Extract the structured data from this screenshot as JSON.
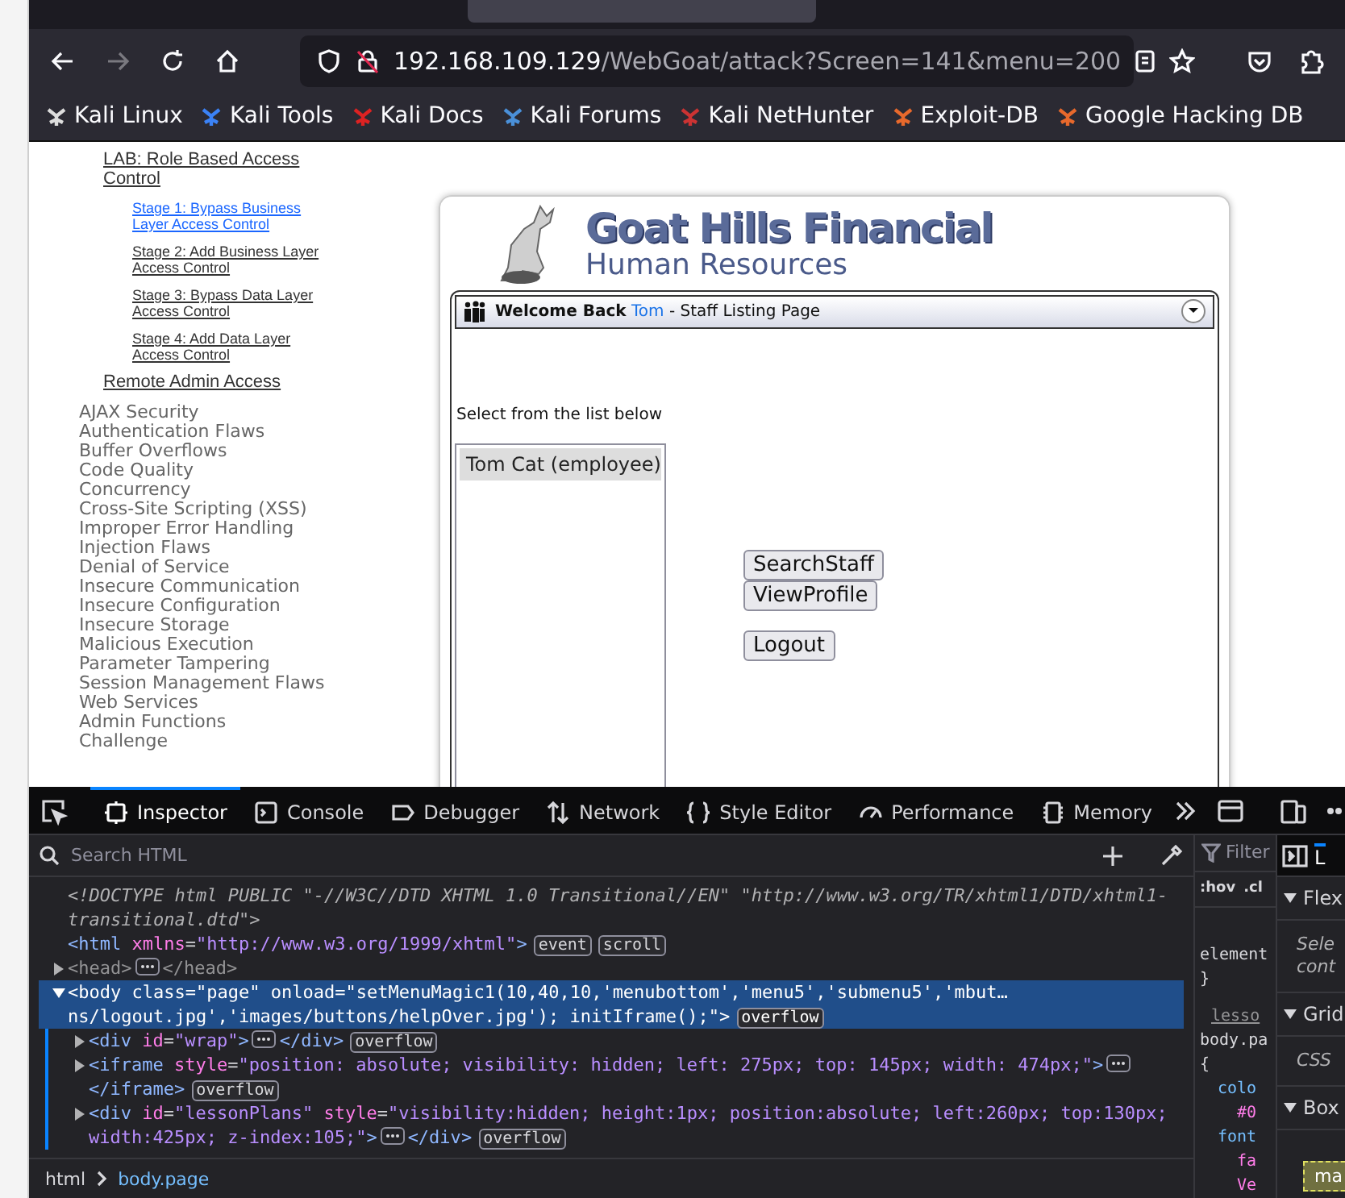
{
  "browser": {
    "nav": [
      {
        "kind": "back",
        "disabled": false
      },
      {
        "kind": "forward",
        "disabled": true
      },
      {
        "kind": "reload",
        "disabled": false
      },
      {
        "kind": "home",
        "disabled": false
      }
    ],
    "url": {
      "host": "192.168.109.129",
      "path": "/WebGoat/attack?Screen=141&menu=200"
    },
    "bookmarks": [
      "Kali Linux",
      "Kali Tools",
      "Kali Docs",
      "Kali Forums",
      "Kali NetHunter",
      "Exploit-DB",
      "Google Hacking DB"
    ]
  },
  "sidebar": {
    "lesson": "LAB: Role Based Access Control",
    "stages": [
      {
        "label": "Stage 1: Bypass Business Layer Access Control",
        "selected": true
      },
      {
        "label": "Stage 2: Add Business Layer Access Control",
        "selected": false
      },
      {
        "label": "Stage 3: Bypass Data Layer Access Control",
        "selected": false
      },
      {
        "label": "Stage 4: Add Data Layer Access Control",
        "selected": false
      }
    ],
    "next_lesson": "Remote Admin Access",
    "categories": [
      "AJAX Security",
      "Authentication Flaws",
      "Buffer Overflows",
      "Code Quality",
      "Concurrency",
      "Cross-Site Scripting (XSS)",
      "Improper Error Handling",
      "Injection Flaws",
      "Denial of Service",
      "Insecure Communication",
      "Insecure Configuration",
      "Insecure Storage",
      "Malicious Execution",
      "Parameter Tampering",
      "Session Management Flaws",
      "Web Services",
      "Admin Functions",
      "Challenge"
    ]
  },
  "app": {
    "title": "Goat Hills Financial",
    "subtitle": "Human Resources",
    "welcome": {
      "greeting": "Welcome Back",
      "user": "Tom",
      "page": "- Staff Listing Page"
    },
    "instruction": "Select from the list below",
    "staff": [
      {
        "label": "Tom Cat (employee)",
        "selected": true
      }
    ],
    "button_groups": [
      [
        "SearchStaff",
        "ViewProfile"
      ],
      [
        "Logout"
      ]
    ]
  },
  "devtools": {
    "tabs": [
      {
        "label": "Inspector",
        "selected": true
      },
      {
        "label": "Console",
        "selected": false
      },
      {
        "label": "Debugger",
        "selected": false
      },
      {
        "label": "Network",
        "selected": false
      },
      {
        "label": "Style Editor",
        "selected": false
      },
      {
        "label": "Performance",
        "selected": false
      },
      {
        "label": "Memory",
        "selected": false
      }
    ],
    "search_placeholder": "Search HTML",
    "tree": [
      {
        "kind": "doctype",
        "open": "<!DOCTYPE html PUBLIC \"-//W3C//DTD XHTML 1.0 Transitional//EN\" \"http://www.w3.org/TR/xhtml1/DTD/xhtml1-transitional.dtd\">"
      },
      {
        "open": "<html xmlns=\"http://www.w3.org/1999/xhtml\">",
        "badges": [
          "event",
          "scroll"
        ],
        "selected": false,
        "children": [
          {
            "open": "<head>",
            "close": "</head>",
            "expanded": false,
            "selected": false,
            "dim": true
          },
          {
            "open": "<body class=\"page\" onload=\"setMenuMagic1(10,40,10,'menubottom','menu5','submenu5','mbut…ns/logout.jpg','images/buttons/helpOver.jpg'); initIframe();\">",
            "badges": [
              "overflow"
            ],
            "expanded": true,
            "selected": true,
            "children": [
              {
                "open": "<div id=\"wrap\">",
                "close": "</div>",
                "badges": [
                  "overflow"
                ],
                "expanded": false,
                "selected": false
              },
              {
                "open": "<iframe style=\"position: absolute; visibility: hidden; left: 275px; top: 145px; width: 474px;\">",
                "close": "</iframe>",
                "badges": [
                  "overflow"
                ],
                "expanded": false,
                "selected": false
              },
              {
                "open": "<div id=\"lessonPlans\" style=\"visibility:hidden; height:1px; position:absolute; left:260px; top:130px; width:425px; z-index:105;\">",
                "close": "</div>",
                "badges": [
                  "overflow"
                ],
                "expanded": false,
                "selected": false
              }
            ]
          }
        ]
      }
    ],
    "breadcrumb": [
      {
        "label": "html",
        "selected": false
      },
      {
        "label": "body.page",
        "selected": true
      }
    ],
    "rules": {
      "filter_placeholder": "Filter",
      "pseudo": [
        ":hov",
        ".cl"
      ],
      "lines": [
        {
          "kind": "selector",
          "text": "element"
        },
        {
          "kind": "brace",
          "text": "}"
        },
        {
          "kind": "source",
          "text": "lesso"
        },
        {
          "kind": "selector",
          "text": "body.pa"
        },
        {
          "kind": "brace",
          "text": "{"
        },
        {
          "kind": "property",
          "text": "colo"
        },
        {
          "kind": "value",
          "text": "#0"
        },
        {
          "kind": "property",
          "text": "font"
        },
        {
          "kind": "value",
          "text": "fa"
        },
        {
          "kind": "value",
          "text": "Ve"
        }
      ]
    },
    "layout": {
      "tab": "L",
      "sections": [
        {
          "title": "Flex",
          "lines": [
            "Sele",
            "cont"
          ]
        },
        {
          "title": "Grid",
          "lines": [
            "CSS"
          ]
        },
        {
          "title": "Box"
        }
      ],
      "box_label": "ma"
    }
  }
}
